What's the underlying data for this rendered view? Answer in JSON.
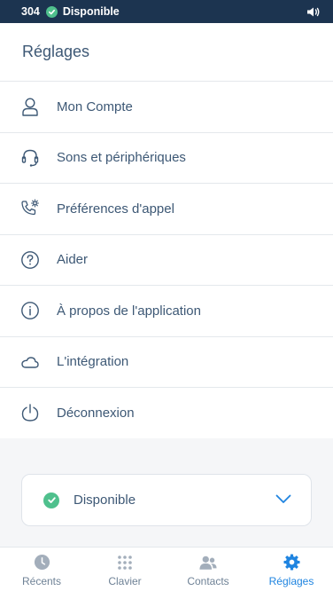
{
  "status_bar": {
    "extension": "304",
    "status": "Disponible",
    "speaker_icon": "speaker-icon"
  },
  "header": {
    "title": "Réglages"
  },
  "menu": {
    "items": [
      {
        "label": "Mon Compte",
        "icon": "user-icon"
      },
      {
        "label": "Sons et périphériques",
        "icon": "headset-icon"
      },
      {
        "label": "Préférences d'appel",
        "icon": "phone-settings-icon"
      },
      {
        "label": "Aider",
        "icon": "help-icon"
      },
      {
        "label": "À propos de l'application",
        "icon": "info-icon"
      },
      {
        "label": "L'intégration",
        "icon": "cloud-icon"
      },
      {
        "label": "Déconnexion",
        "icon": "power-icon"
      }
    ]
  },
  "status_select": {
    "value": "Disponible"
  },
  "tabs": [
    {
      "label": "Récents",
      "icon": "clock-icon",
      "active": false
    },
    {
      "label": "Clavier",
      "icon": "keypad-icon",
      "active": false
    },
    {
      "label": "Contacts",
      "icon": "contacts-icon",
      "active": false
    },
    {
      "label": "Réglages",
      "icon": "gear-icon",
      "active": true
    }
  ],
  "colors": {
    "status_bar_bg": "#1c3450",
    "available_green": "#4fc08d",
    "accent_blue": "#1f84e0",
    "icon_grey": "#a3aebb"
  }
}
